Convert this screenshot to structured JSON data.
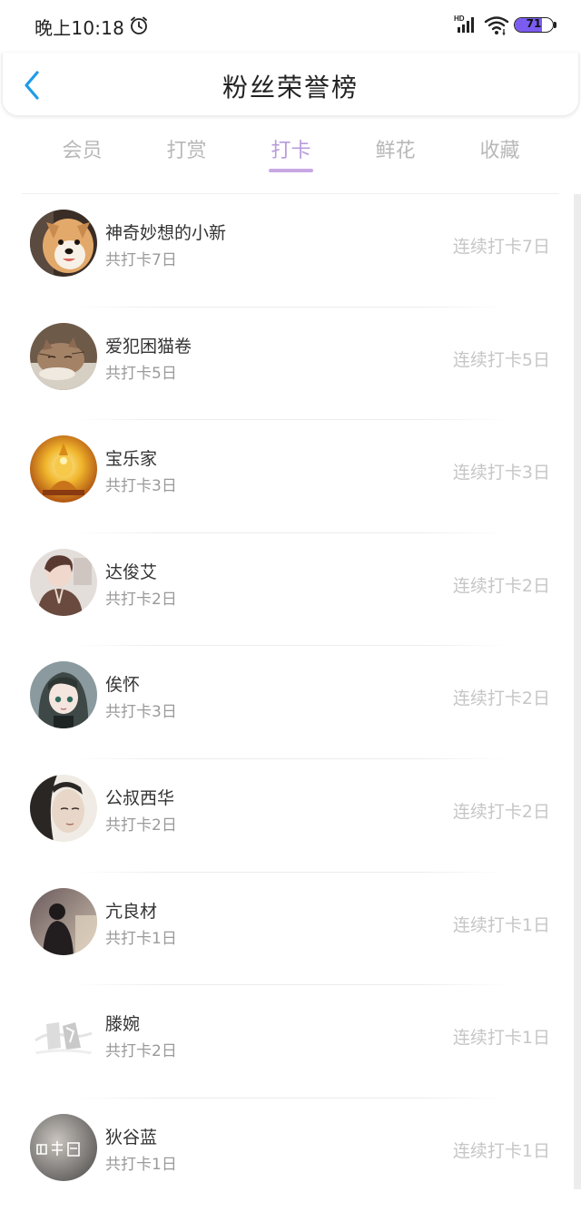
{
  "status_bar": {
    "time": "晚上10:18",
    "battery_level": "71",
    "battery_fraction": 0.71,
    "signal_label": "HD",
    "icons": [
      "alarm-icon",
      "signal-icon",
      "wifi-icon",
      "battery-icon"
    ]
  },
  "header": {
    "title": "粉丝荣誉榜",
    "back_icon": "chevron-left-icon"
  },
  "tabs": [
    {
      "label": "会员",
      "active": false
    },
    {
      "label": "打赏",
      "active": false
    },
    {
      "label": "打卡",
      "active": true
    },
    {
      "label": "鲜花",
      "active": false
    },
    {
      "label": "收藏",
      "active": false
    }
  ],
  "colors": {
    "accent": "#c8a8e4",
    "active_tab_text": "#b89bdc",
    "back_arrow": "#1e9be8",
    "battery_fill": "#7b5cf0"
  },
  "fans": [
    {
      "name": "神奇妙想的小新",
      "total": "共打卡7日",
      "streak": "连续打卡7日",
      "avatar": "dog-photo"
    },
    {
      "name": "爱犯困猫卷",
      "total": "共打卡5日",
      "streak": "连续打卡5日",
      "avatar": "cat-photo"
    },
    {
      "name": "宝乐家",
      "total": "共打卡3日",
      "streak": "连续打卡3日",
      "avatar": "golden-buddha-photo"
    },
    {
      "name": "达俊艾",
      "total": "共打卡2日",
      "streak": "连续打卡2日",
      "avatar": "girl-photo"
    },
    {
      "name": "俟怀",
      "total": "共打卡3日",
      "streak": "连续打卡2日",
      "avatar": "anime-girl-photo"
    },
    {
      "name": "公叔西华",
      "total": "共打卡2日",
      "streak": "连续打卡2日",
      "avatar": "man-portrait-photo"
    },
    {
      "name": "亢良材",
      "total": "共打卡1日",
      "streak": "连续打卡1日",
      "avatar": "silhouette-photo"
    },
    {
      "name": "滕婉",
      "total": "共打卡2日",
      "streak": "连续打卡1日",
      "avatar": "default-placeholder"
    },
    {
      "name": "狄谷蓝",
      "total": "共打卡1日",
      "streak": "连续打卡1日",
      "avatar": "text-circle-photo"
    }
  ]
}
